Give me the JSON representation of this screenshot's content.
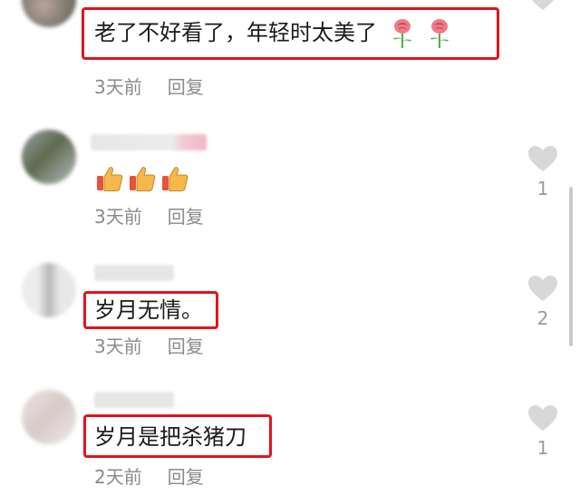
{
  "comments": [
    {
      "text": "老了不好看了，年轻时太美了",
      "emoji": "rose",
      "time": "3天前",
      "reply": "回复",
      "likes": ""
    },
    {
      "text": "",
      "emoji": "thumbs-up",
      "time": "3天前",
      "reply": "回复",
      "likes": "1"
    },
    {
      "text": "岁月无情。",
      "emoji": "",
      "time": "3天前",
      "reply": "回复",
      "likes": "2"
    },
    {
      "text": "岁月是把杀猪刀",
      "emoji": "",
      "time": "2天前",
      "reply": "回复",
      "likes": "1"
    }
  ],
  "colors": {
    "highlight": "#e0141e",
    "meta": "#8a8a8a",
    "heart": "#d8d8d8"
  }
}
